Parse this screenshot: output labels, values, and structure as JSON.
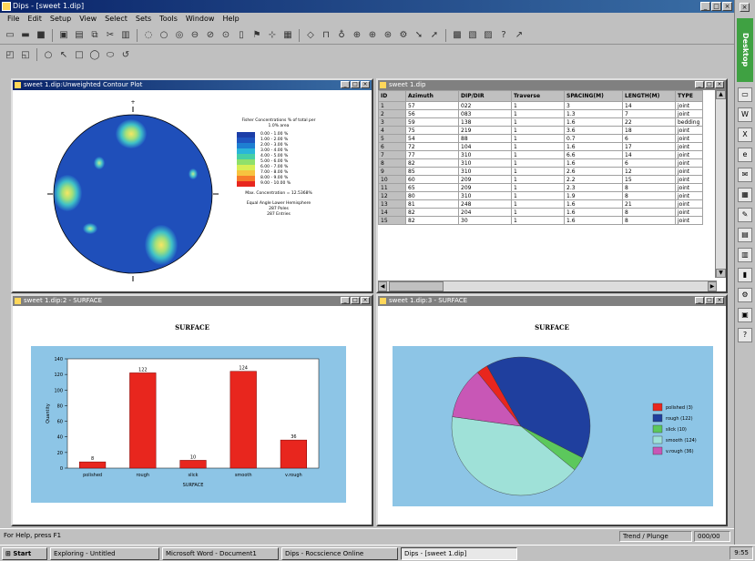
{
  "window": {
    "title": "Dips - [sweet 1.dip]"
  },
  "menu": [
    "File",
    "Edit",
    "Setup",
    "View",
    "Select",
    "Sets",
    "Tools",
    "Window",
    "Help"
  ],
  "plot_window": {
    "title": "sweet 1.dip:Unweighted Contour Plot",
    "legend_title": "Fisher Concentrations % of total per 1.0% area",
    "legend_values": [
      "0.00 - 1.00 %",
      "1.00 - 2.00 %",
      "2.00 - 3.00 %",
      "3.00 - 4.00 %",
      "4.00 - 5.00 %",
      "5.00 - 6.00 %",
      "6.00 - 7.00 %",
      "7.00 - 8.00 %",
      "8.00 - 9.00 %",
      "9.00 - 10.00 %"
    ],
    "legend_colors": [
      "#1c3ea8",
      "#1f55c0",
      "#1e7fd2",
      "#2ab5d9",
      "#46cfa5",
      "#8fe06b",
      "#d7ee54",
      "#f7c33f",
      "#f77b2a",
      "#e8261e"
    ],
    "max_conc": "Max. Concentration = 12.5368%",
    "equal_angle": "Equal Angle Lower Hemisphere",
    "poles": "287 Poles",
    "entries": "287 Entries"
  },
  "table_window": {
    "title": "sweet 1.dip",
    "headers": [
      "ID",
      "Azimuth",
      "DIP/DIR",
      "Traverse",
      "SPACING(M)",
      "LENGTH(M)",
      "TYPE"
    ],
    "rows": [
      [
        "1",
        "57",
        "022",
        "1",
        "3",
        "14",
        "joint"
      ],
      [
        "2",
        "56",
        "083",
        "1",
        "1.3",
        "7",
        "joint"
      ],
      [
        "3",
        "59",
        "138",
        "1",
        "1.6",
        "22",
        "bedding"
      ],
      [
        "4",
        "75",
        "219",
        "1",
        "3.6",
        "18",
        "joint"
      ],
      [
        "5",
        "54",
        "88",
        "1",
        "0.7",
        "6",
        "joint"
      ],
      [
        "6",
        "72",
        "104",
        "1",
        "1.6",
        "17",
        "joint"
      ],
      [
        "7",
        "77",
        "310",
        "1",
        "6.6",
        "14",
        "joint"
      ],
      [
        "8",
        "82",
        "310",
        "1",
        "1.6",
        "6",
        "joint"
      ],
      [
        "9",
        "85",
        "310",
        "1",
        "2.6",
        "12",
        "joint"
      ],
      [
        "10",
        "60",
        "209",
        "1",
        "2.2",
        "15",
        "joint"
      ],
      [
        "11",
        "65",
        "209",
        "1",
        "2.3",
        "8",
        "joint"
      ],
      [
        "12",
        "80",
        "310",
        "1",
        "1.9",
        "8",
        "joint"
      ],
      [
        "13",
        "81",
        "248",
        "1",
        "1.6",
        "21",
        "joint"
      ],
      [
        "14",
        "82",
        "204",
        "1",
        "1.6",
        "8",
        "joint"
      ],
      [
        "15",
        "82",
        "30",
        "1",
        "1.6",
        "8",
        "joint"
      ]
    ]
  },
  "bar_window": {
    "title": "sweet 1.dip:2 - SURFACE"
  },
  "pie_window": {
    "title": "sweet 1.dip:3 - SURFACE"
  },
  "status": {
    "left": "For Help, press F1",
    "trend": "Trend / Plunge",
    "coords": "000/00"
  },
  "taskbar": {
    "start": "Start",
    "buttons": [
      "Exploring - Untitled",
      "Microsoft Word - Document1",
      "Dips - Rocscience Online",
      "Dips - [sweet 1.dip]"
    ],
    "clock": "9:55"
  },
  "sidebar": {
    "desktop": "Desktop"
  },
  "chart_data": [
    {
      "type": "bar",
      "title": "SURFACE",
      "xlabel": "SURFACE",
      "ylabel": "Quantity",
      "categories": [
        "polished",
        "rough",
        "slick",
        "smooth",
        "v.rough"
      ],
      "values": [
        8,
        122,
        10,
        124,
        36
      ],
      "ylim": [
        0,
        140
      ],
      "yticks": [
        0,
        20,
        40,
        60,
        80,
        100,
        120,
        140
      ],
      "color": "#e8261e"
    },
    {
      "type": "pie",
      "title": "SURFACE",
      "labels": [
        "polished (3)",
        "rough (122)",
        "slick (10)",
        "smooth (124)",
        "v.rough (36)"
      ],
      "values": [
        8,
        122,
        10,
        124,
        36
      ],
      "colors": [
        "#e8261e",
        "#1f3f9e",
        "#5cc85c",
        "#9fe1d8",
        "#c857b6"
      ]
    }
  ]
}
